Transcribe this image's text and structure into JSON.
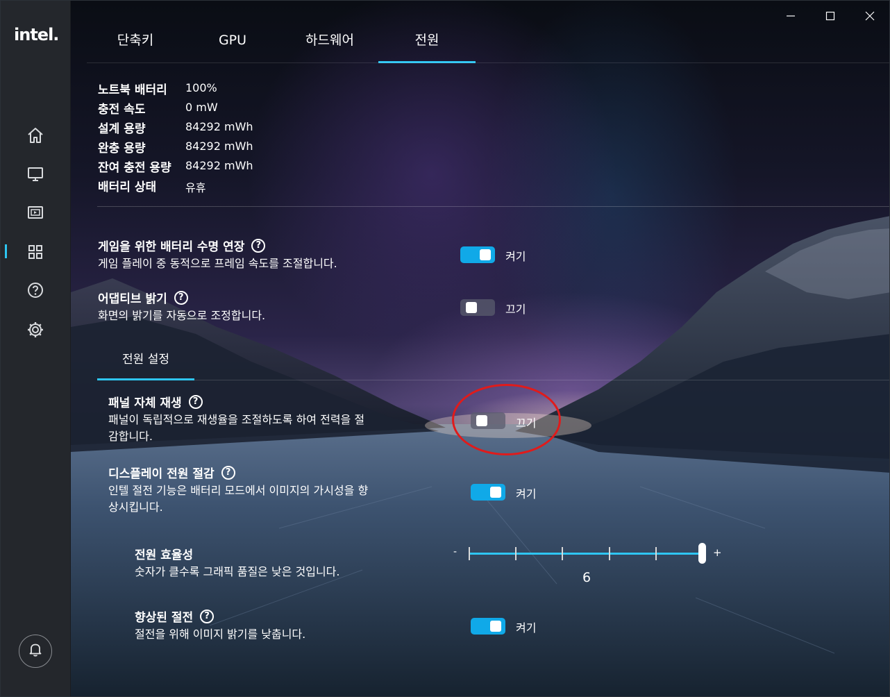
{
  "app": {
    "logo": "intel."
  },
  "tabs": [
    {
      "label": "단축키",
      "active": false
    },
    {
      "label": "GPU",
      "active": false
    },
    {
      "label": "하드웨어",
      "active": false
    },
    {
      "label": "전원",
      "active": true
    }
  ],
  "battery": [
    {
      "key": "노트북 배터리",
      "value": "100%"
    },
    {
      "key": "충전 속도",
      "value": "0 mW"
    },
    {
      "key": "설계 용량",
      "value": "84292 mWh"
    },
    {
      "key": "완충 용량",
      "value": "84292 mWh"
    },
    {
      "key": "잔여 충전 용량",
      "value": "84292 mWh"
    },
    {
      "key": "배터리 상태",
      "value": "유휴"
    }
  ],
  "settings": {
    "battery_boost": {
      "title": "게임을 위한 배터리 수명 연장",
      "desc": "게임 플레이 중 동적으로 프레임 속도를 조절합니다.",
      "state": "켜기",
      "on": true
    },
    "adaptive_brightness": {
      "title": "어댑티브 밝기",
      "desc": "화면의 밝기를 자동으로 조정합니다.",
      "state": "끄기",
      "on": false
    }
  },
  "power_section": {
    "tab_label": "전원 설정",
    "panel_self_refresh": {
      "title": "패널 자체 재생",
      "desc_line1": "패널이 독립적으로 재생율을 조절하도록 하여 전력을 절",
      "desc_line2": "감합니다.",
      "state": "끄기",
      "on": false
    },
    "display_power_saving": {
      "title": "디스플레이 전원 절감",
      "desc_line1": "인텔 절전 기능은 배터리 모드에서 이미지의 가시성을 향",
      "desc_line2": "상시킵니다.",
      "state": "켜기",
      "on": true
    },
    "power_efficiency": {
      "title": "전원 효율성",
      "desc": "숫자가 클수록 그래픽 품질은 낮은 것입니다.",
      "minus": "-",
      "plus": "+",
      "value": "6",
      "level": 6,
      "min": 1,
      "max": 6
    },
    "enhanced_power_saving": {
      "title": "향상된 절전",
      "desc": "절전을 위해 이미지 밝기를 낮춥니다.",
      "state": "켜기",
      "on": true
    }
  },
  "icons": {
    "help": "?",
    "sidebar": [
      "home-icon",
      "display-icon",
      "video-icon",
      "apps-grid-icon",
      "help-circle-icon",
      "gear-icon"
    ],
    "bell": "bell-icon",
    "window": [
      "minimize-icon",
      "maximize-icon",
      "close-icon"
    ]
  },
  "colors": {
    "accent": "#2ec6f2",
    "toggle_on": "#10a9e8",
    "highlight_ring": "#e01b1b",
    "sidebar_bg": "#24272c"
  }
}
